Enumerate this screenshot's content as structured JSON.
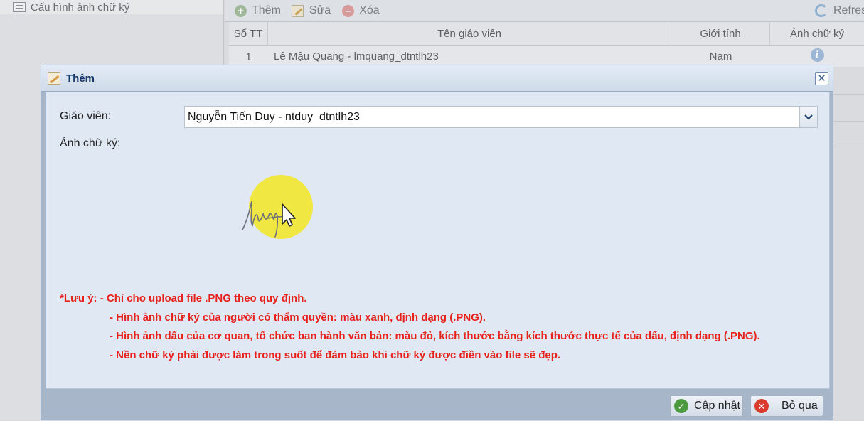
{
  "left_panel": {
    "item_label": "Cấu hình ảnh chữ ký",
    "item_icon": "list-icon"
  },
  "toolbar": {
    "add_label": "Thêm",
    "edit_label": "Sửa",
    "delete_label": "Xóa",
    "refresh_label": "Refres"
  },
  "grid": {
    "columns": [
      "Số TT",
      "Tên giáo viên",
      "Giới tính",
      "Ảnh chữ ký"
    ],
    "rows": [
      {
        "stt": "1",
        "name": "Lê Mậu Quang - lmquang_dtntlh23",
        "gender": "Nam",
        "signature_icon": "info-icon"
      }
    ]
  },
  "modal": {
    "title": "Thêm",
    "teacher_label": "Giáo viên:",
    "teacher_value": "Nguyễn Tiến Duy - ntduy_dtntlh23",
    "signature_label": "Ảnh chữ ký:",
    "notes": [
      "*Lưu ý: - Chỉ cho upload file .PNG theo quy định.",
      "- Hình ảnh chữ ký của người có thẩm quyền: màu xanh, định dạng (.PNG).",
      "- Hình ảnh dấu của cơ quan, tổ chức ban hành văn bản: màu đỏ, kích thước bằng kích thước thực tế của dấu, định dạng (.PNG).",
      "- Nền chữ ký phải được làm trong suốt để đảm bảo khi chữ ký được điền vào file sẽ đẹp."
    ],
    "update_label": "Cập nhật",
    "cancel_label": "Bỏ qua"
  },
  "colors": {
    "note_red": "#e8211b",
    "modal_header_text": "#16396d",
    "cursor_highlight": "#f4e629"
  }
}
